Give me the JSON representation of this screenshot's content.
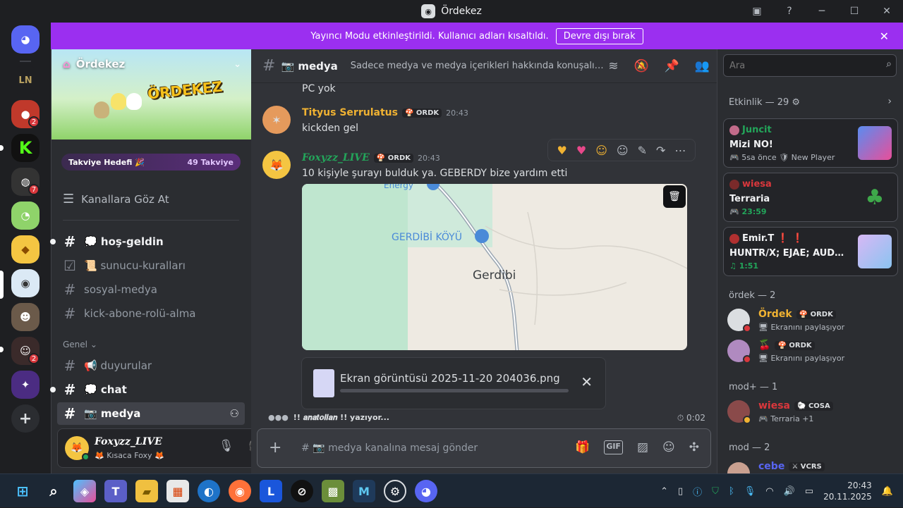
{
  "window": {
    "title": "Ördekez"
  },
  "notice": {
    "text": "Yayıncı Modu etkinleştirildi. Kullanıcı adları kısaltıldı.",
    "button": "Devre dışı bırak"
  },
  "server": {
    "name": "Ördekez",
    "banner_logo": "ÖRDEKEZ"
  },
  "boost": {
    "label": "Takviye Hedefi 🎉",
    "count": "49 Takviye"
  },
  "sidebar": {
    "browse": "Kanallara Göz At",
    "channels": [
      {
        "label": "💭 hoş-geldin",
        "state": "unread"
      },
      {
        "label": "📜 sunucu-kuralları",
        "state": "rules"
      },
      {
        "label": "sosyal-medya",
        "state": "normal"
      },
      {
        "label": "kick-abone-rolü-alma",
        "state": "normal"
      }
    ],
    "category": "Genel ⌄",
    "category_channels": [
      {
        "label": "📢 duyurular",
        "state": "normal"
      },
      {
        "label": "💭 chat",
        "state": "unread"
      },
      {
        "label": "📷 medya",
        "state": "active"
      }
    ]
  },
  "guild_badges": [
    "2",
    "7",
    "2"
  ],
  "user": {
    "name": "Foxyzz_LIVE",
    "status": "🦊 Kısaca Foxy 🦊"
  },
  "channel": {
    "name": "📷 medya",
    "topic": "Sadece medya ve medya içerikleri hakkında konuşalım, so..."
  },
  "messages": {
    "partial": "PC yok",
    "m1": {
      "author": "Tityus Serrulatus",
      "tag": "🍄 ORDK",
      "time": "20:43",
      "text": "kickden gel"
    },
    "m2": {
      "author": "Foxyzz_LIVE",
      "tag": "🍄 ORDK",
      "time": "20:43",
      "text": "10 kişiyle şurayı bulduk ya. GEBERDY bize yardım etti"
    }
  },
  "map": {
    "village": "GERDİBİ KÖYÜ",
    "town": "Gerdibi",
    "top_label": "Energy"
  },
  "attachment": {
    "filename": "Ekran görüntüsü 2025-11-20 204036.png"
  },
  "typing": {
    "text": "!! 𝒂𝒏𝒂𝒕𝒐𝒍𝒊𝒂𝒏 !! yazıyor...",
    "slowmode": "⏱ 0:02"
  },
  "composer": {
    "placeholder": "# 📷 medya kanalına mesaj gönder"
  },
  "members": {
    "search_placeholder": "Ara",
    "activity_header": "Etkinlik — 29 ⚙",
    "activities": [
      {
        "name": "Juncit",
        "title": "Mizi NO!",
        "sub": "🎮 5sa önce  🛡 New Player",
        "color": "#23a55a"
      },
      {
        "name": "wiesa",
        "title": "Terraria",
        "sub": "🎮 23:59",
        "color": "#da373c"
      },
      {
        "name": "Emir.T ❗ ❗",
        "title": "HUNTR/X; EJAE; AUDREY ...",
        "sub": "♫ 1:51",
        "color": "#f2f3f5"
      }
    ],
    "groups": [
      {
        "label": "ördek — 2"
      },
      {
        "label": "mod+ — 1"
      },
      {
        "label": "mod — 2"
      }
    ],
    "list": [
      {
        "name": "Ördek",
        "tag": "🍄 ORDK",
        "status": "🖥 Ekranını paylaşıyor",
        "color": "#f0b232"
      },
      {
        "name": "🍒",
        "tag": "🍄 ORDK",
        "status": "🖥 Ekranını paylaşıyor",
        "color": "#f2f3f5"
      },
      {
        "name": "wiesa",
        "tag": "🐑 COSA",
        "status": "🎮 Terraria +1",
        "color": "#da373c"
      },
      {
        "name": "cebe",
        "tag": "⚔ VCRS",
        "status": "",
        "color": "#5865f2"
      }
    ]
  },
  "taskbar": {
    "time": "20:43",
    "date": "20.11.2025"
  }
}
